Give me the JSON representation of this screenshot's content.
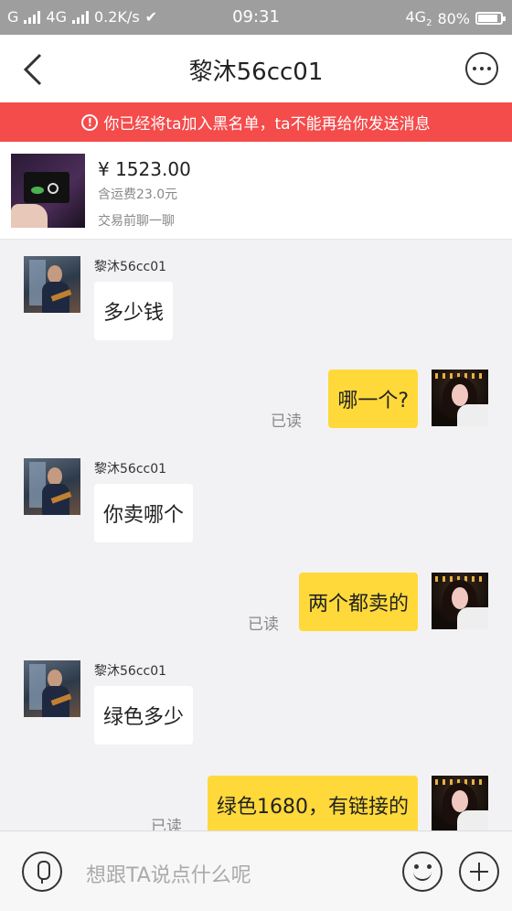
{
  "status_bar": {
    "carrier_left": "G",
    "network_2": "4G",
    "speed": "0.2K/s",
    "time": "09:31",
    "network_right": "4G",
    "network_right_sub": "2",
    "battery": "80%"
  },
  "header": {
    "title": "黎沐56cc01",
    "back_icon": "chevron-left-icon",
    "more_icon": "more-options-icon"
  },
  "banner": {
    "text": "你已经将ta加入黑名单，ta不能再给你发送消息",
    "color": "#f44b4b"
  },
  "product": {
    "price": "¥ 1523.00",
    "shipping": "含运费23.0元",
    "chat_hint": "交易前聊一聊"
  },
  "messages": [
    {
      "side": "left",
      "sender": "黎沐56cc01",
      "text": "多少钱"
    },
    {
      "side": "right",
      "text": "哪一个?",
      "status": "已读"
    },
    {
      "side": "left",
      "sender": "黎沐56cc01",
      "text": "你卖哪个"
    },
    {
      "side": "right",
      "text": "两个都卖的",
      "status": "已读"
    },
    {
      "side": "left",
      "sender": "黎沐56cc01",
      "text": "绿色多少"
    },
    {
      "side": "right",
      "text": "绿色1680，有链接的",
      "status": "已读"
    }
  ],
  "input": {
    "placeholder": "想跟TA说点什么呢"
  },
  "colors": {
    "self_bubble": "#ffd93a",
    "other_bubble": "#ffffff",
    "background": "#f2f2f4"
  }
}
